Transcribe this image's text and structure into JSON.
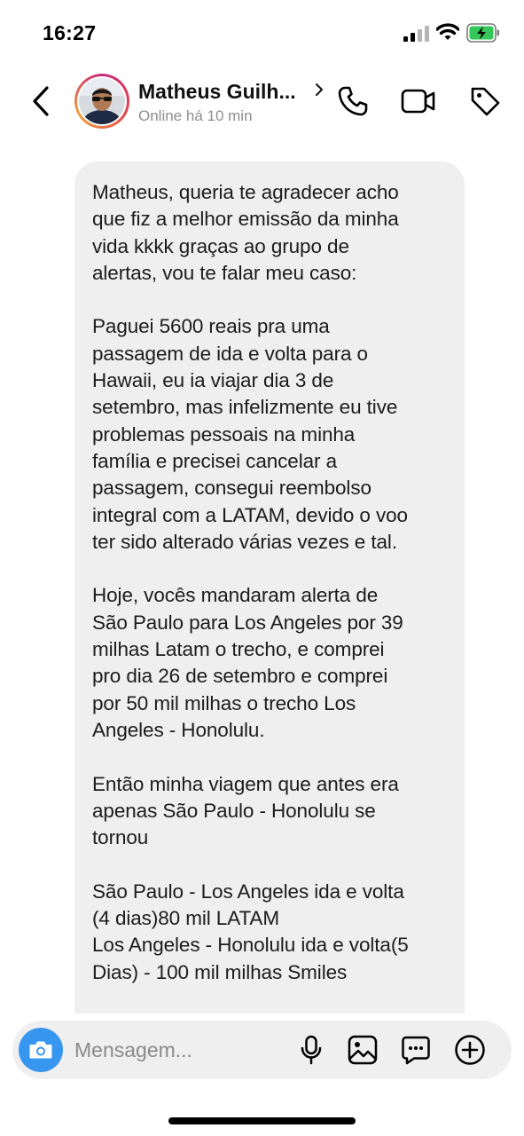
{
  "status_bar": {
    "time": "16:27",
    "icons": [
      "signal-icon",
      "wifi-icon",
      "battery-charging-icon"
    ]
  },
  "header": {
    "contact_name": "Matheus Guilh...",
    "status": "Online há 10 min",
    "icons": [
      "back-chevron-icon",
      "chevron-right-icon",
      "phone-icon",
      "video-camera-icon",
      "tag-icon"
    ]
  },
  "message": {
    "paragraphs": [
      "Matheus, queria te agradecer acho\nque fiz a melhor emissão da minha\nvida kkkk graças ao grupo de\nalertas, vou te falar meu caso:",
      "Paguei 5600 reais pra uma\npassagem de ida e volta para o\nHawaii, eu ia viajar dia 3 de\nsetembro, mas infelizmente eu tive\nproblemas pessoais na minha\nfamília e precisei cancelar a\npassagem, consegui reembolso\nintegral com a LATAM, devido o voo\nter sido alterado várias vezes e tal.",
      "Hoje, vocês mandaram alerta de\nSão Paulo para Los Angeles por 39\nmilhas Latam o trecho, e comprei\npro dia 26 de setembro e comprei\npor 50 mil milhas o trecho Los\nAngeles - Honolulu.",
      "Então minha viagem que antes era\napenas São Paulo - Honolulu se\ntornou",
      "São Paulo - Los Angeles ida e volta\n(4 dias)80 mil LATAM\nLos Angeles - Honolulu ida e volta(5\nDias) - 100 mil milhas Smiles"
    ]
  },
  "composer": {
    "placeholder": "Mensagem...",
    "value": "",
    "icons": [
      "camera-icon",
      "microphone-icon",
      "gallery-icon",
      "sticker-icon",
      "plus-circle-icon"
    ]
  },
  "colors": {
    "accent": "#3797f0",
    "bubble": "#efefef",
    "secondary_text": "#8e8e8e",
    "battery_charge": "#34c759"
  }
}
